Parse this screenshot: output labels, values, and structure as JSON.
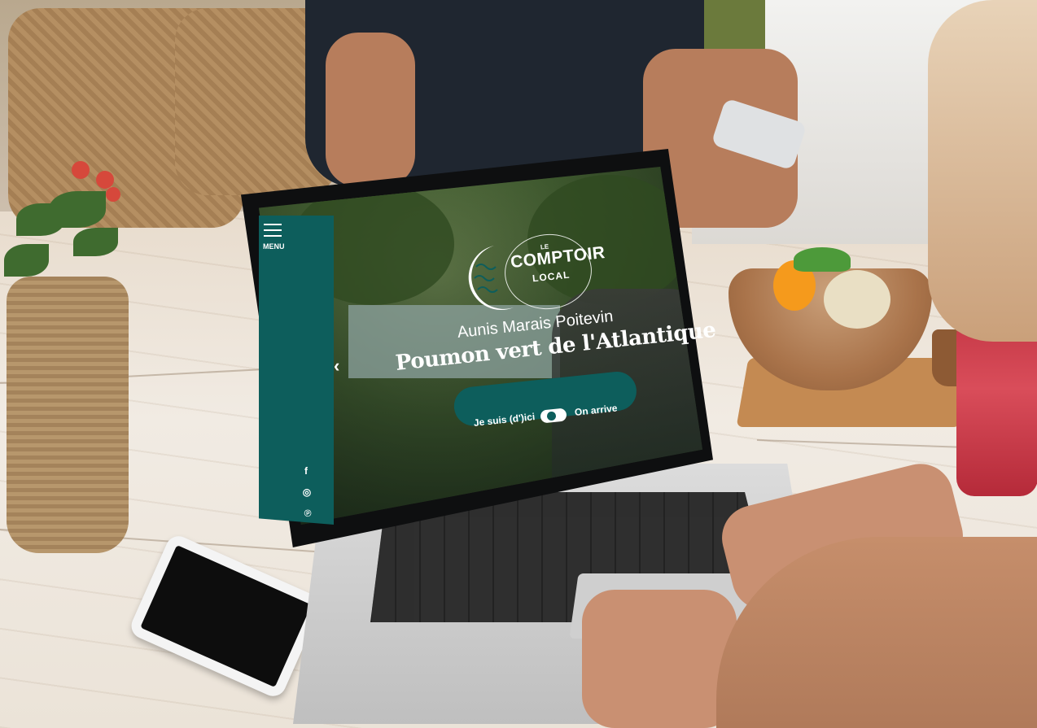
{
  "website": {
    "menu_label": "MENU",
    "logo": {
      "le": "LE",
      "comptoir": "COMPTOIR",
      "local": "LOCAL"
    },
    "hero": {
      "subtitle": "Aunis Marais Poitevin",
      "title": "Poumon vert de l'Atlantique"
    },
    "toggle": {
      "left_label": "Je suis (d')ici",
      "right_label": "On arrive"
    },
    "social": {
      "facebook": "f",
      "instagram": "◎",
      "pinterest": "℗"
    },
    "prev_arrow": "‹",
    "colors": {
      "brand_teal": "#0d5e5c",
      "text": "#ffffff"
    }
  }
}
